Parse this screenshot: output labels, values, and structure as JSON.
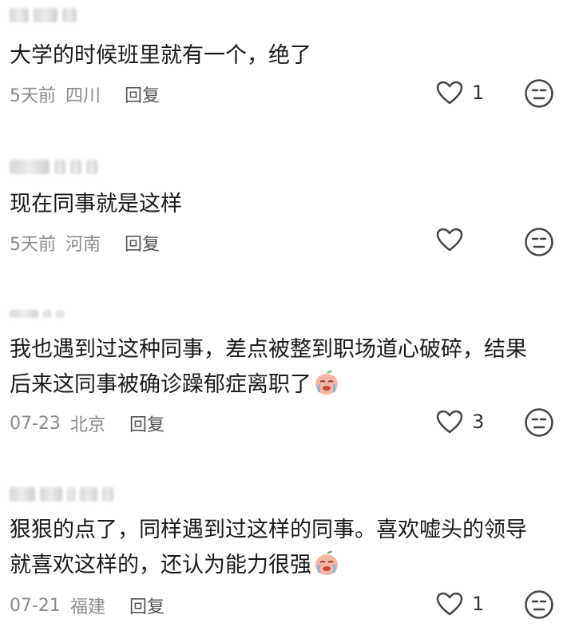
{
  "comments": [
    {
      "text": [
        "大学的时候班里就有一个，绝了"
      ],
      "time": "5天前",
      "location": "四川",
      "reply": "回复",
      "likes": "1",
      "emoji": false
    },
    {
      "text": [
        "现在同事就是这样"
      ],
      "time": "5天前",
      "location": "河南",
      "reply": "回复",
      "likes": "",
      "emoji": false
    },
    {
      "text": [
        "我也遇到过这种同事，差点被整到职场道心破碎，结果",
        "后来这同事被确诊躁郁症离职了"
      ],
      "time": "07-23",
      "location": "北京",
      "reply": "回复",
      "likes": "3",
      "emoji": true
    },
    {
      "text": [
        "狠狠的点了，同样遇到过这样的同事。喜欢嘘头的领导",
        "就喜欢这样的，还认为能力很强"
      ],
      "time": "07-21",
      "location": "福建",
      "reply": "回复",
      "likes": "1",
      "emoji": true
    }
  ],
  "icons": {
    "like": "heart-outline-icon",
    "dislike": "neutral-face-icon",
    "inline_emoji": "crying-peach-emoji"
  }
}
